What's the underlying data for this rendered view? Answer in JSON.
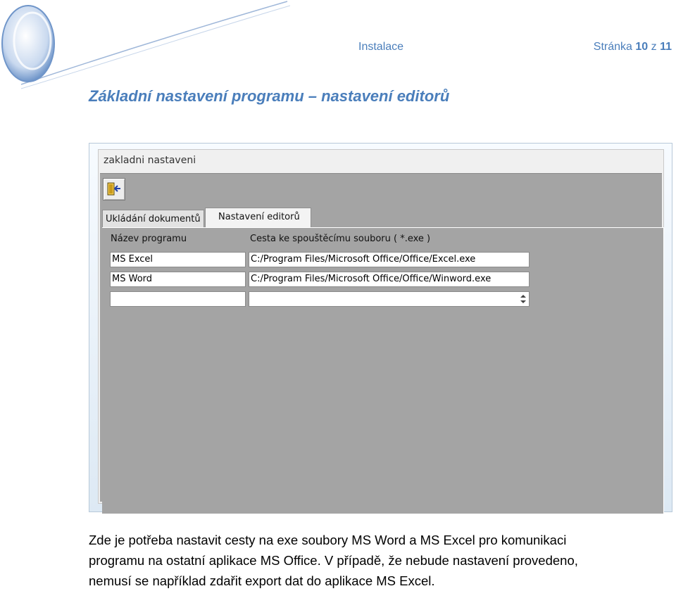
{
  "header": {
    "section": "Instalace",
    "page_prefix": "Stránka",
    "page_current": "10",
    "page_sep": "z",
    "page_total": "11"
  },
  "heading": "Základní nastavení programu – nastavení editorů",
  "window": {
    "title": "zakladni nastaveni",
    "exit_icon": "exit-door-icon",
    "tabs": [
      "Ukládání dokumentů",
      "Nastavení editorů"
    ],
    "active_tab": "Nastavení editorů",
    "columns": [
      "Název programu",
      "Cesta ke spouštěcímu souboru  ( *.exe )"
    ],
    "rows": [
      {
        "name": "MS Excel",
        "path": "C:/Program Files/Microsoft Office/Office/Excel.exe"
      },
      {
        "name": "MS Word",
        "path": "C:/Program Files/Microsoft Office/Office/Winword.exe"
      },
      {
        "name": "",
        "path": ""
      }
    ]
  },
  "paragraph": [
    "Zde je potřeba nastavit cesty na exe soubory MS Word a MS Excel pro komunikaci",
    "programu na ostatní aplikace MS Office. V případě, že nebude nastavení provedeno,",
    "nemusí se například zdařit export dat do aplikace MS Excel."
  ],
  "colors": {
    "accent": "#4a7ebb",
    "window_bg": "#a4a4a4"
  }
}
